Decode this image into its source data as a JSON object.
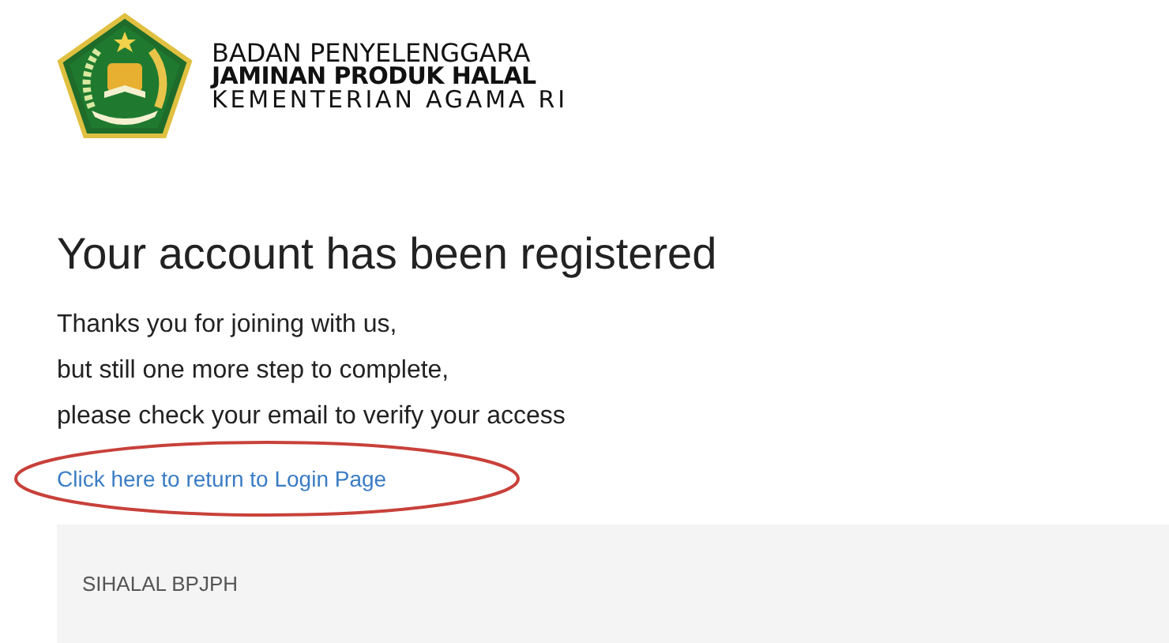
{
  "header": {
    "org_lines": [
      {
        "text": "BADAN PENYELENGGARA",
        "kind": "regular"
      },
      {
        "text": "JAMINAN PRODUK HALAL",
        "kind": "bold"
      },
      {
        "text": "KEMENTERIAN AGAMA RI",
        "kind": "spaced"
      }
    ]
  },
  "title": "Your account has been registered",
  "message_lines": [
    "Thanks you for joining with us,",
    "but still one more step to complete,",
    "please check your email to verify your access"
  ],
  "link": {
    "label": "Click here to return to Login Page",
    "circled": true
  },
  "footer": {
    "text": "SIHALAL BPJPH"
  }
}
